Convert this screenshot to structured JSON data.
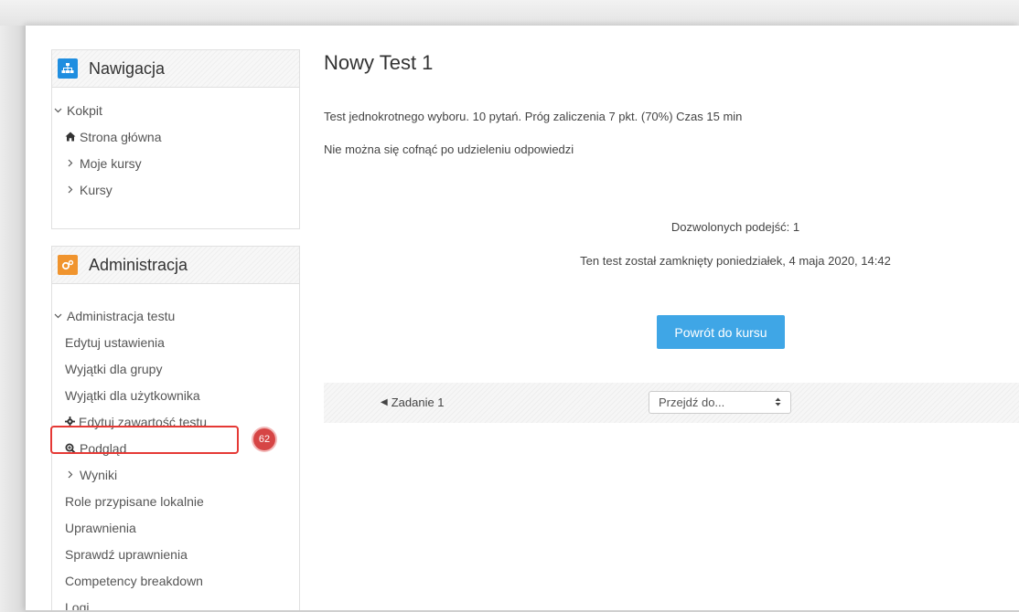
{
  "colors": {
    "nav_icon_bg": "#1f8ee0",
    "admin_icon_bg": "#f0942e",
    "primary_button": "#3fa6e6",
    "highlight": "#e53935",
    "badge": "#d64545"
  },
  "navigation": {
    "title": "Nawigacja",
    "icon": "sitemap-icon",
    "items": [
      {
        "label": "Kokpit",
        "caret": "chevron-down-icon"
      },
      {
        "label": "Strona główna",
        "icon": "home-icon"
      },
      {
        "label": "Moje kursy",
        "caret": "chevron-right-icon"
      },
      {
        "label": "Kursy",
        "caret": "chevron-right-icon"
      }
    ]
  },
  "administration": {
    "title": "Administracja",
    "icon": "gears-icon",
    "items": [
      {
        "label": "Administracja testu",
        "caret": "chevron-down-icon"
      },
      {
        "label": "Edytuj ustawienia"
      },
      {
        "label": "Wyjątki dla grupy"
      },
      {
        "label": "Wyjątki dla użytkownika"
      },
      {
        "label": "Edytuj zawartość testu",
        "icon": "gear-icon"
      },
      {
        "label": "Podgląd",
        "icon": "zoom-icon"
      },
      {
        "label": "Wyniki",
        "caret": "chevron-right-icon"
      },
      {
        "label": "Role przypisane lokalnie"
      },
      {
        "label": "Uprawnienia"
      },
      {
        "label": "Sprawdź uprawnienia"
      },
      {
        "label": "Competency breakdown"
      },
      {
        "label": "Logi"
      }
    ]
  },
  "annotation": {
    "badge": "62"
  },
  "main": {
    "title": "Nowy Test 1",
    "description": "Test jednokrotnego wyboru. 10 pytań. Próg zaliczenia 7 pkt. (70%) Czas 15 min",
    "note": "Nie można się cofnąć po udzieleniu odpowiedzi",
    "attempts": "Dozwolonych podejść: 1",
    "closed": "Ten test został zamknięty poniedziałek, 4 maja 2020, 14:42",
    "back_button": "Powrót do kursu",
    "prev_activity": "Zadanie 1",
    "jump_select": {
      "selected": "Przejdź do..."
    }
  }
}
